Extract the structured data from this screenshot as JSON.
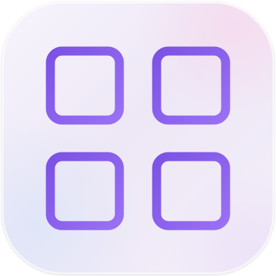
{
  "icon": {
    "name": "grid-four-squares-icon",
    "background_colors": [
      "#f7f3fc",
      "#efe9f7",
      "#f7e6f2",
      "#e4e9f8"
    ],
    "stroke_colors": [
      "#7d55e6",
      "#9b6ff5"
    ],
    "grid": {
      "rows": 2,
      "columns": 2
    }
  }
}
